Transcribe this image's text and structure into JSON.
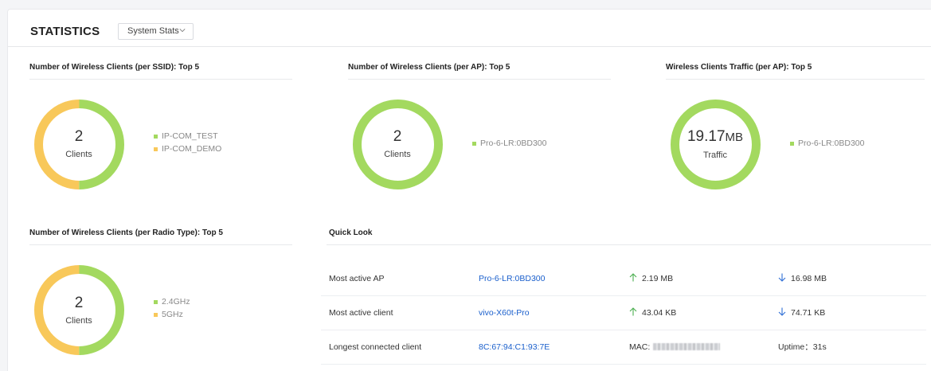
{
  "header": {
    "title": "STATISTICS",
    "select_value": "System Stats"
  },
  "colors": {
    "green": "#a3d95f",
    "orange": "#f8c85a",
    "link": "#1a5fcc",
    "up_arrow": "#4caf50",
    "down_arrow": "#2f6fd6"
  },
  "panels": {
    "ssid": {
      "title": "Number of Wireless Clients (per SSID): Top 5",
      "value": "2",
      "label": "Clients",
      "legend": [
        "IP-COM_TEST",
        "IP-COM_DEMO"
      ],
      "segments": [
        0.5,
        0.5
      ]
    },
    "ap": {
      "title": "Number of Wireless Clients (per AP): Top 5",
      "value": "2",
      "label": "Clients",
      "legend": [
        "Pro-6-LR:0BD300"
      ],
      "segments": [
        1.0
      ]
    },
    "traffic": {
      "title": "Wireless Clients Traffic (per AP): Top 5",
      "value": "19.17",
      "unit": "MB",
      "label": "Traffic",
      "legend": [
        "Pro-6-LR:0BD300"
      ],
      "segments": [
        1.0
      ]
    },
    "radio": {
      "title": "Number of Wireless Clients (per Radio Type): Top 5",
      "value": "2",
      "label": "Clients",
      "legend": [
        "2.4GHz",
        "5GHz"
      ],
      "segments": [
        0.5,
        0.5
      ]
    }
  },
  "quick_look": {
    "title": "Quick Look",
    "rows": [
      {
        "label": "Most active AP",
        "link": "Pro-6-LR:0BD300",
        "up": "2.19 MB",
        "down": "16.98 MB"
      },
      {
        "label": "Most active client",
        "link": "vivo-X60t-Pro",
        "up": "43.04 KB",
        "down": "74.71 KB"
      },
      {
        "label": "Longest connected client",
        "link": "8C:67:94:C1:93:7E",
        "mac_label": "MAC:",
        "uptime": "Uptime：31s"
      }
    ]
  }
}
